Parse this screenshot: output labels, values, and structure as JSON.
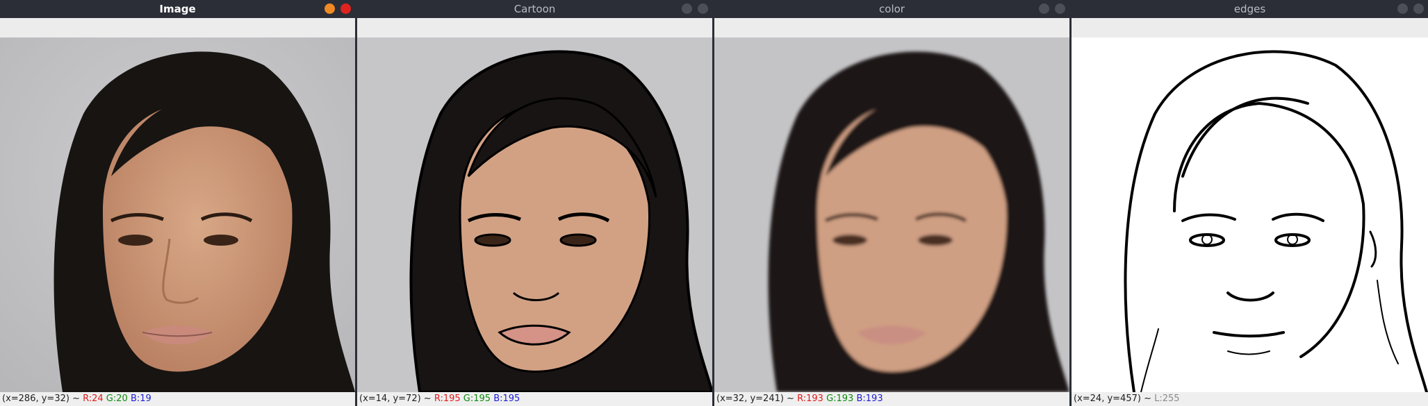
{
  "windows": [
    {
      "id": "image",
      "title": "Image",
      "active": true,
      "status": {
        "coords": "(x=286, y=32) ~ ",
        "r": "R:24",
        "g": "G:20",
        "b": "B:19"
      }
    },
    {
      "id": "cartoon",
      "title": "Cartoon",
      "active": false,
      "status": {
        "coords": "(x=14, y=72) ~ ",
        "r": "R:195",
        "g": "G:195",
        "b": "B:195"
      }
    },
    {
      "id": "color",
      "title": "color",
      "active": false,
      "status": {
        "coords": "(x=32, y=241) ~ ",
        "r": "R:193",
        "g": "G:193",
        "b": "B:193"
      }
    },
    {
      "id": "edges",
      "title": "edges",
      "active": false,
      "status": {
        "coords": "(x=24, y=457) ~ ",
        "l": "L:255"
      }
    }
  ],
  "colors": {
    "titlebar": "#2b2e37",
    "minimize_active": "#f08a24",
    "close_active": "#e0231f",
    "red_channel": "#e01b1b",
    "green_channel": "#0d8a0d",
    "blue_channel": "#1b1bd6",
    "luminance": "#8a8a8a"
  },
  "icons": [
    "minimize-icon",
    "close-icon"
  ]
}
